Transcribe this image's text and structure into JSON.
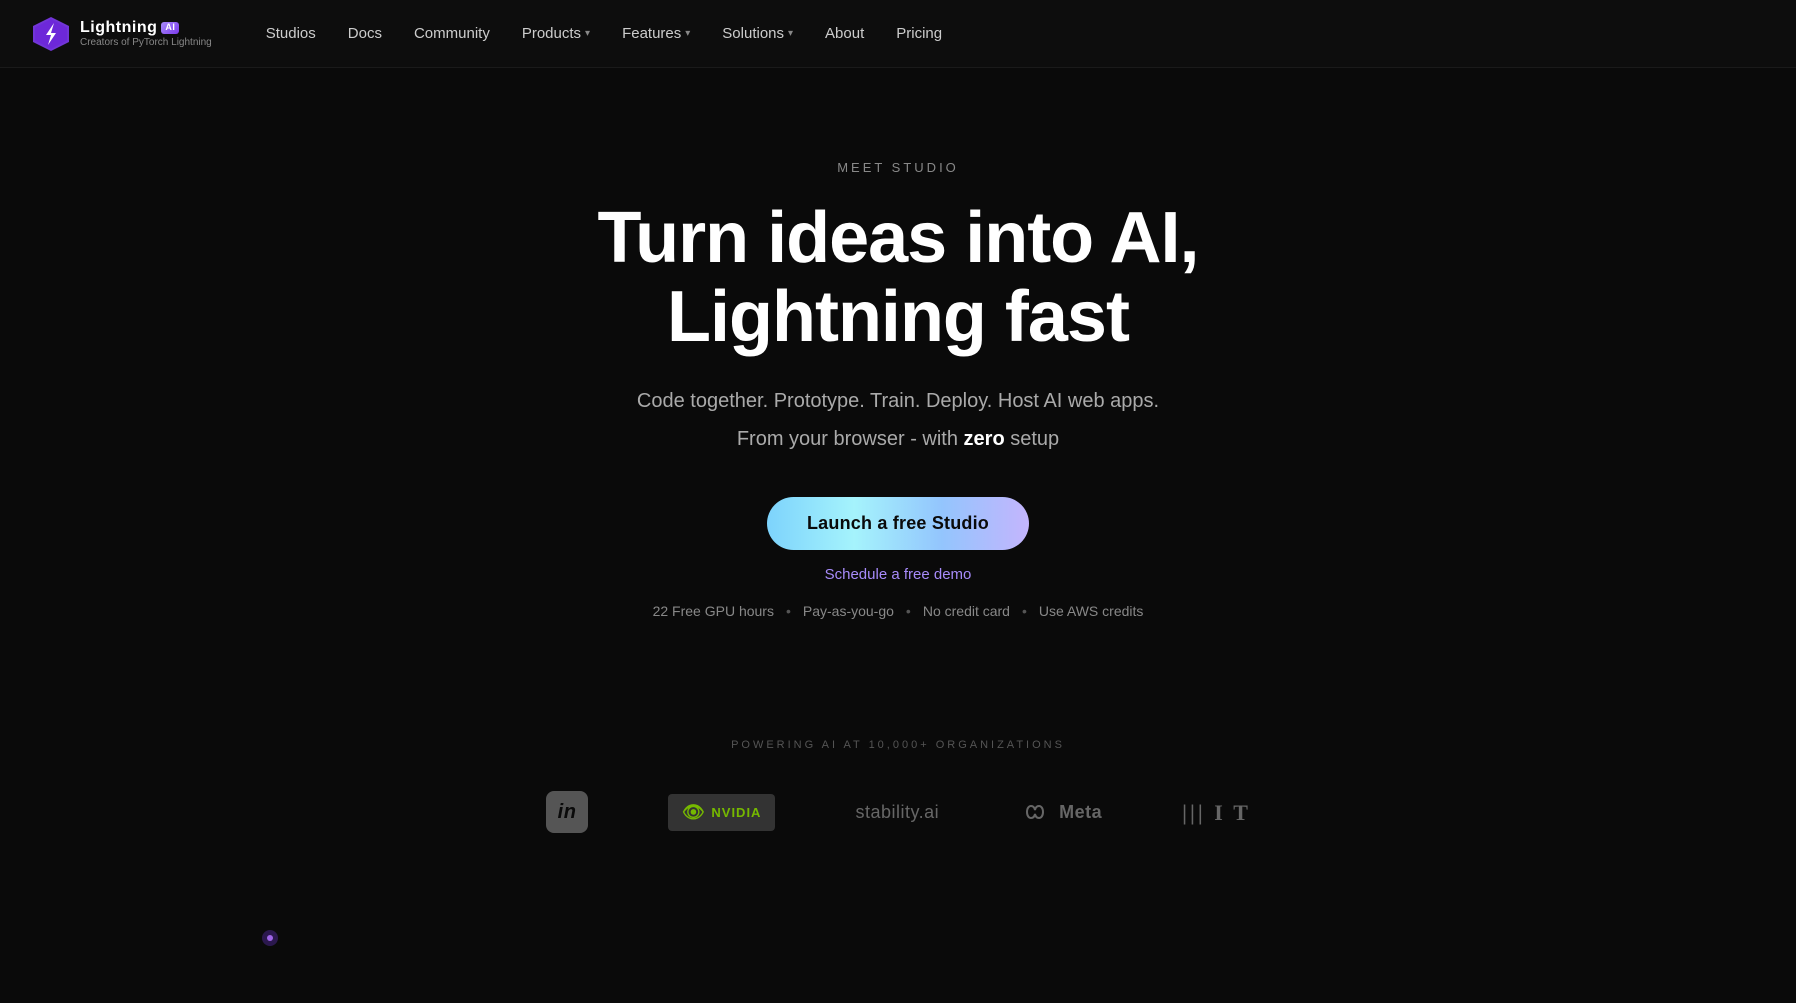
{
  "brand": {
    "name": "Lightning",
    "ai_badge": "AI",
    "subtitle": "Creators of PyTorch Lightning"
  },
  "nav": {
    "links": [
      {
        "label": "Studios",
        "has_chevron": false,
        "id": "studios"
      },
      {
        "label": "Docs",
        "has_chevron": false,
        "id": "docs"
      },
      {
        "label": "Community",
        "has_chevron": false,
        "id": "community"
      },
      {
        "label": "Products",
        "has_chevron": true,
        "id": "products"
      },
      {
        "label": "Features",
        "has_chevron": true,
        "id": "features"
      },
      {
        "label": "Solutions",
        "has_chevron": true,
        "id": "solutions"
      },
      {
        "label": "About",
        "has_chevron": false,
        "id": "about"
      },
      {
        "label": "Pricing",
        "has_chevron": false,
        "id": "pricing"
      }
    ]
  },
  "hero": {
    "meet_label": "MEET STUDIO",
    "title": "Turn ideas into AI, Lightning fast",
    "subtitle_line1": "Code together. Prototype. Train. Deploy. Host AI web apps.",
    "subtitle_line2_pre": "From your browser - with ",
    "subtitle_zero": "zero",
    "subtitle_line2_post": " setup",
    "cta_button": "Launch a free Studio",
    "schedule_link": "Schedule a free demo",
    "features": [
      "22 Free GPU hours",
      "Pay-as-you-go",
      "No credit card",
      "Use AWS credits"
    ]
  },
  "powering": {
    "label": "POWERING AI AT 10,000+ ORGANIZATIONS",
    "companies": [
      {
        "name": "LinkedIn",
        "id": "linkedin"
      },
      {
        "name": "NVIDIA",
        "id": "nvidia"
      },
      {
        "name": "stability.ai",
        "id": "stability"
      },
      {
        "name": "Meta",
        "id": "meta"
      },
      {
        "name": "MIT",
        "id": "mit"
      }
    ]
  }
}
